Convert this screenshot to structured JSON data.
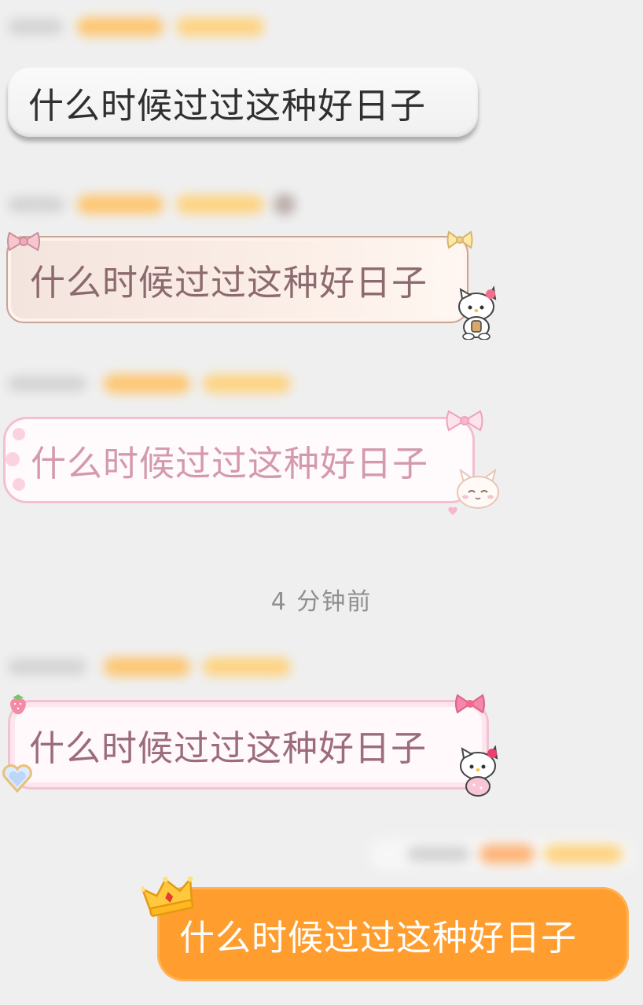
{
  "messages": [
    {
      "text": "什么时候过过这种好日子",
      "bubble_style": "plain-gray"
    },
    {
      "text": "什么时候过过这种好日子",
      "bubble_style": "hello-kitty-cream",
      "decoration": "hello-kitty"
    },
    {
      "text": "什么时候过过这种好日子",
      "bubble_style": "pink-paw",
      "decoration": "white-cat"
    },
    {
      "text": "什么时候过过这种好日子",
      "bubble_style": "pink-hello-kitty",
      "decoration": "hello-kitty"
    },
    {
      "text": "什么时候过过这种好日子",
      "bubble_style": "orange-self",
      "decoration": "crown",
      "color": "#ff9d2e"
    }
  ],
  "timestamp": "4 分钟前"
}
